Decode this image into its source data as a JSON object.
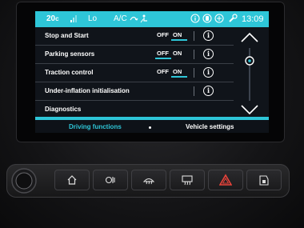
{
  "status_bar": {
    "temp_left": "20",
    "temp_unit": "c",
    "fan_label": "Lo",
    "ac_label": "A/C",
    "clock": "13:09"
  },
  "settings": {
    "rows": [
      {
        "label": "Stop and Start",
        "toggle": {
          "off": "OFF",
          "on": "ON",
          "selected": "on"
        },
        "has_info": true
      },
      {
        "label": "Parking sensors",
        "toggle": {
          "off": "OFF",
          "on": "ON",
          "selected": "off"
        },
        "has_info": true
      },
      {
        "label": "Traction control",
        "toggle": {
          "off": "OFF",
          "on": "ON",
          "selected": "on"
        },
        "has_info": true
      },
      {
        "label": "Under-inflation initialisation",
        "toggle": null,
        "has_info": true
      },
      {
        "label": "Diagnostics",
        "toggle": null,
        "has_info": false
      }
    ],
    "info_glyph": "i"
  },
  "tabs": [
    {
      "label": "Driving functions",
      "active": true
    },
    {
      "label": "Vehicle settings",
      "active": false
    }
  ],
  "colors": {
    "accent": "#2ec6d8",
    "screen_bg": "#10141a",
    "hazard": "#e8433a"
  },
  "hardware_buttons": [
    {
      "icon": "home-icon"
    },
    {
      "icon": "fan-icon"
    },
    {
      "icon": "rear-defrost-icon"
    },
    {
      "icon": "front-defrost-icon"
    },
    {
      "icon": "hazard-icon"
    },
    {
      "icon": "door-lock-icon"
    }
  ]
}
